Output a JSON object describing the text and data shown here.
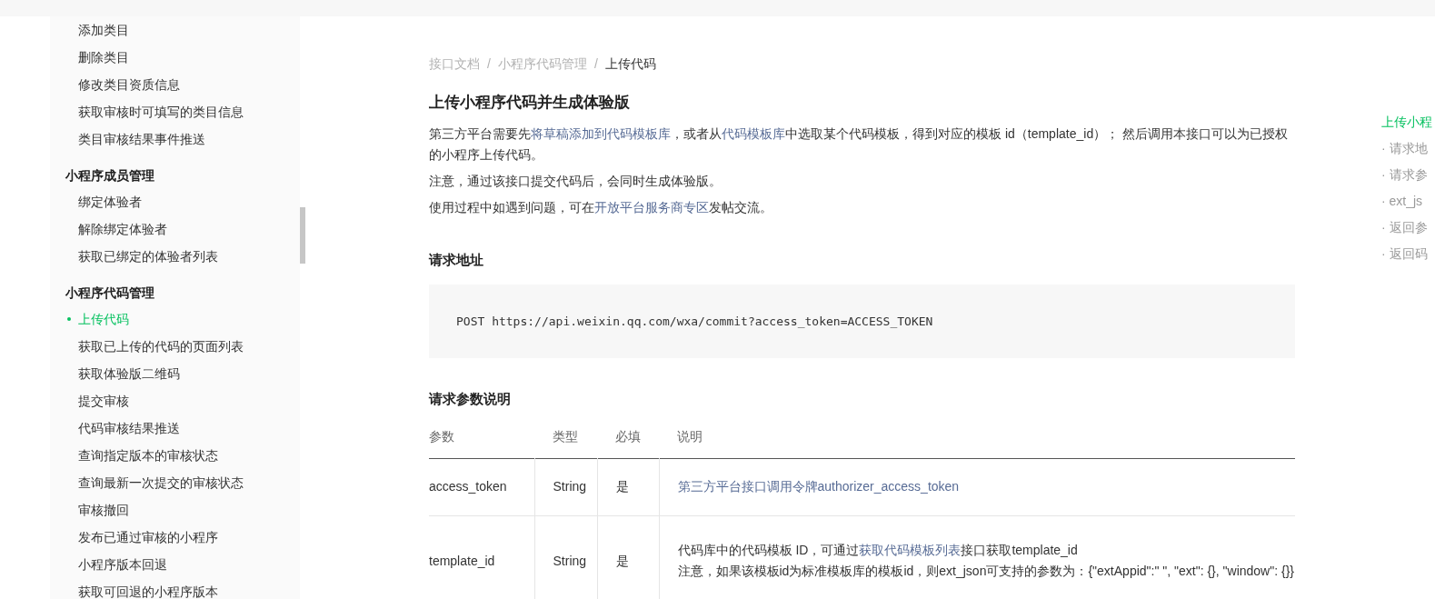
{
  "sidebar": {
    "groups": [
      {
        "items": [
          {
            "label": "添加类目",
            "selected": false
          },
          {
            "label": "删除类目",
            "selected": false
          },
          {
            "label": "修改类目资质信息",
            "selected": false
          },
          {
            "label": "获取审核时可填写的类目信息",
            "selected": false
          },
          {
            "label": "类目审核结果事件推送",
            "selected": false
          }
        ]
      },
      {
        "title": "小程序成员管理",
        "items": [
          {
            "label": "绑定体验者",
            "selected": false
          },
          {
            "label": "解除绑定体验者",
            "selected": false
          },
          {
            "label": "获取已绑定的体验者列表",
            "selected": false
          }
        ]
      },
      {
        "title": "小程序代码管理",
        "items": [
          {
            "label": "上传代码",
            "selected": true
          },
          {
            "label": "获取已上传的代码的页面列表",
            "selected": false
          },
          {
            "label": "获取体验版二维码",
            "selected": false
          },
          {
            "label": "提交审核",
            "selected": false
          },
          {
            "label": "代码审核结果推送",
            "selected": false
          },
          {
            "label": "查询指定版本的审核状态",
            "selected": false
          },
          {
            "label": "查询最新一次提交的审核状态",
            "selected": false
          },
          {
            "label": "审核撤回",
            "selected": false
          },
          {
            "label": "发布已通过审核的小程序",
            "selected": false
          },
          {
            "label": "小程序版本回退",
            "selected": false
          },
          {
            "label": "获取可回退的小程序版本",
            "selected": false
          }
        ]
      }
    ]
  },
  "breadcrumb": [
    {
      "label": "接口文档",
      "current": false
    },
    {
      "separator": "/",
      "label": "小程序代码管理",
      "current": false
    },
    {
      "separator": "/",
      "label": "上传代码",
      "current": true
    }
  ],
  "title": "上传小程序代码并生成体验版",
  "paragraphs": [
    [
      {
        "text": "第三方平台需要先"
      },
      {
        "text": "将草稿添加到代码模板库",
        "link": true
      },
      {
        "text": "，或者从"
      },
      {
        "text": "代码模板库",
        "link": true
      },
      {
        "text": "中选取某个代码模板，得到对应的模板 id（template_id）；  然后调用本接口可以为已授权的小程序上传代码。"
      }
    ],
    [
      {
        "text": "注意，通过该接口提交代码后，会同时生成体验版。"
      }
    ],
    [
      {
        "text": "使用过程中如遇到问题，可在"
      },
      {
        "text": "开放平台服务商专区",
        "link": true
      },
      {
        "text": "发帖交流。"
      }
    ]
  ],
  "request_url": {
    "heading": "请求地址",
    "code": "POST https://api.weixin.qq.com/wxa/commit?access_token=ACCESS_TOKEN"
  },
  "params": {
    "heading": "请求参数说明",
    "table": {
      "columns": [
        "参数",
        "类型",
        "必填",
        "说明"
      ],
      "rows": [
        {
          "param": "access_token",
          "type": "String",
          "required": "是",
          "description": [
            [
              {
                "text": "第三方平台接口调用令牌authorizer_access_token",
                "link": true
              }
            ]
          ]
        },
        {
          "param": "template_id",
          "type": "String",
          "required": "是",
          "description": [
            [
              {
                "text": "代码库中的代码模板 ID，可通过"
              },
              {
                "text": "获取代码模板列表",
                "link": true
              },
              {
                "text": "接口获取template_id"
              }
            ],
            [
              {
                "text": "注意，如果该模板id为标准模板库的模板id，则ext_json可支持的参数为：{\"extAppid\":\" \", \"ext\": {}, \"window\": {}}"
              }
            ]
          ]
        }
      ]
    }
  },
  "toc": [
    {
      "label": "上传小程",
      "selected": true
    },
    {
      "label": "· 请求地",
      "selected": false
    },
    {
      "label": "· 请求参",
      "selected": false
    },
    {
      "label": "· ext_js",
      "selected": false
    },
    {
      "label": "· 返回参",
      "selected": false
    },
    {
      "label": "· 返回码",
      "selected": false
    }
  ]
}
